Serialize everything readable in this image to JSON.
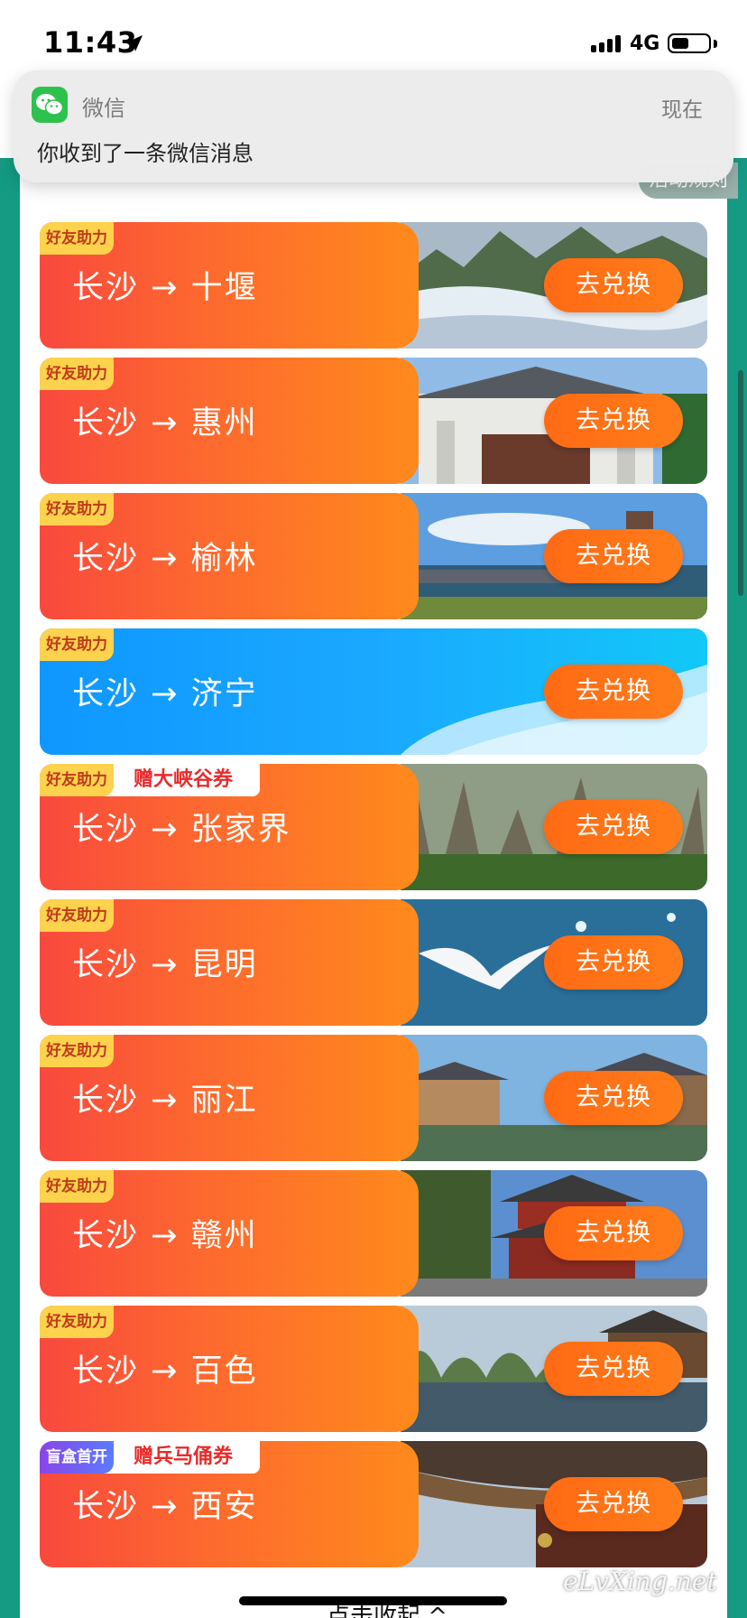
{
  "status_bar": {
    "time": "11:43",
    "network": "4G"
  },
  "notification": {
    "app": "微信",
    "time": "现在",
    "message": "你收到了一条微信消息"
  },
  "rules_button": "活动规则",
  "exchange_label": "去兑换",
  "routes": [
    {
      "tag": "好友助力",
      "route": "长沙 → 十堰",
      "promo": "",
      "style": "orange",
      "scene": "mountain-clouds"
    },
    {
      "tag": "好友助力",
      "route": "长沙 → 惠州",
      "promo": "",
      "style": "orange",
      "scene": "memorial-arch"
    },
    {
      "tag": "好友助力",
      "route": "长沙 → 榆林",
      "promo": "",
      "style": "orange",
      "scene": "stone-bridge"
    },
    {
      "tag": "好友助力",
      "route": "长沙 → 济宁",
      "promo": "",
      "style": "blue",
      "scene": "bullet-train"
    },
    {
      "tag": "好友助力",
      "route": "长沙 → 张家界",
      "promo": "赠大峡谷券",
      "style": "orange",
      "scene": "stone-peaks"
    },
    {
      "tag": "好友助力",
      "route": "长沙 → 昆明",
      "promo": "",
      "style": "orange",
      "scene": "seagull-lake"
    },
    {
      "tag": "好友助力",
      "route": "长沙 → 丽江",
      "promo": "",
      "style": "orange",
      "scene": "old-town"
    },
    {
      "tag": "好友助力",
      "route": "长沙 → 赣州",
      "promo": "",
      "style": "orange",
      "scene": "pagoda-tower"
    },
    {
      "tag": "好友助力",
      "route": "长沙 → 百色",
      "promo": "",
      "style": "orange",
      "scene": "karst-river"
    },
    {
      "tag": "盲盒首开",
      "route": "长沙 → 西安",
      "promo": "赠兵马俑券",
      "style": "orange",
      "scene": "ancient-roof"
    }
  ],
  "collapse_label": "点击收起 ^",
  "watermark": "eLvXing.net",
  "colors": {
    "teal_bg": "#159b83",
    "card_orange": "#fd6a2e",
    "card_blue": "#1aa8ff",
    "button_orange": "#ff6a14",
    "tag_yellow": "#fdd24d"
  }
}
